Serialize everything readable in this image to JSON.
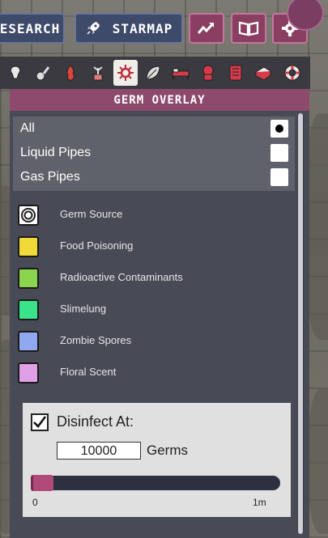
{
  "topbar": {
    "research_label": "ESEARCH",
    "starmap_label": "STARMAP",
    "icons": [
      "trend-icon",
      "book-icon",
      "gear-icon"
    ]
  },
  "filters": [
    {
      "icon": "oxygen-icon"
    },
    {
      "icon": "power-icon"
    },
    {
      "icon": "temperature-icon"
    },
    {
      "icon": "farming-icon"
    },
    {
      "icon": "germ-icon",
      "active": true
    },
    {
      "icon": "leaf-icon"
    },
    {
      "icon": "bed-icon"
    },
    {
      "icon": "suit-icon"
    },
    {
      "icon": "radiation-icon"
    },
    {
      "icon": "rooms-icon"
    },
    {
      "icon": "lifebuoy-icon"
    }
  ],
  "panel": {
    "title": "GERM OVERLAY",
    "options": [
      {
        "label": "All",
        "selected": true
      },
      {
        "label": "Liquid Pipes",
        "selected": false
      },
      {
        "label": "Gas Pipes",
        "selected": false
      }
    ],
    "legend": [
      {
        "label": "Germ Source",
        "color": "#ffffff",
        "icon": "target-icon"
      },
      {
        "label": "Food Poisoning",
        "color": "#f2d93a"
      },
      {
        "label": "Radioactive Contaminants",
        "color": "#8ad44e"
      },
      {
        "label": "Slimelung",
        "color": "#3ae38a"
      },
      {
        "label": "Zombie Spores",
        "color": "#90a8f0"
      },
      {
        "label": "Floral Scent",
        "color": "#e0a0e8"
      }
    ],
    "disinfect": {
      "label": "Disinfect At:",
      "checked": true,
      "value": "10000",
      "unit": "Germs",
      "slider_min": "0",
      "slider_max": "1m",
      "slider_level": 0.01
    }
  },
  "colors": {
    "accent": "#8d4a6c",
    "nav": "#3e4a6a",
    "panel": "#484b55"
  }
}
